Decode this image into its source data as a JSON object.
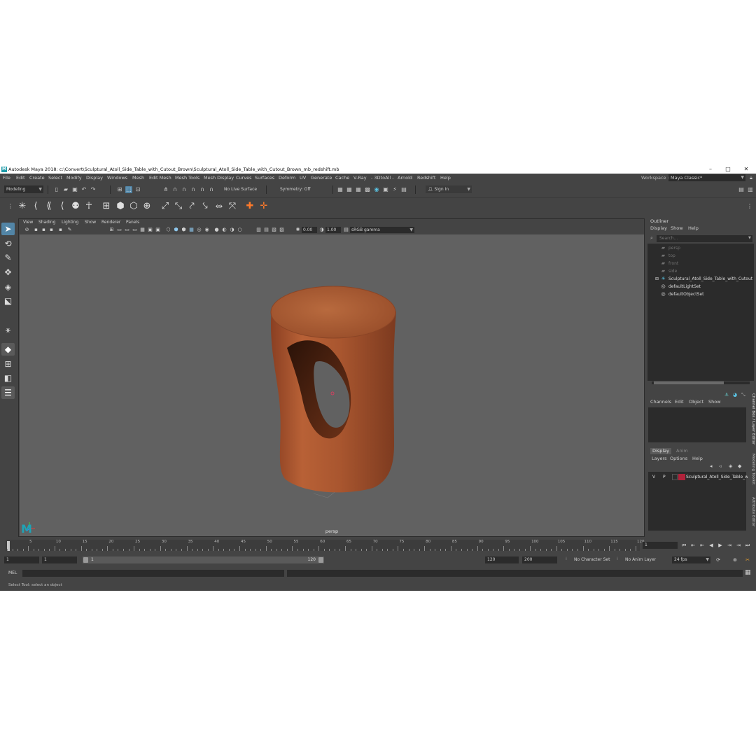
{
  "window": {
    "app_icon": "M",
    "title": "Autodesk Maya 2018: c:\\Convert\\Sculptural_Atoll_Side_Table_with_Cutout_Brown\\Sculptural_Atoll_Side_Table_with_Cutout_Brown_mb_redshift.mb",
    "minimize": "–",
    "maximize": "□",
    "close": "✕"
  },
  "menubar": {
    "items": [
      "File",
      "Edit",
      "Create",
      "Select",
      "Modify",
      "Display",
      "Windows",
      "Mesh",
      "Edit Mesh",
      "Mesh Tools",
      "Mesh Display",
      "Curves",
      "Surfaces",
      "Deform",
      "UV",
      "Generate",
      "Cache",
      "V-Ray",
      "- 3DtoAll -",
      "Arnold",
      "Redshift",
      "Help"
    ],
    "workspace_label": "Workspace :",
    "workspace_value": "Maya Classic*"
  },
  "statusline": {
    "mode": "Modeling",
    "live_surface": "No Live Surface",
    "symmetry": "Symmetry: Off",
    "sign_in": "Sign In"
  },
  "viewport": {
    "menu": [
      "View",
      "Shading",
      "Lighting",
      "Show",
      "Renderer",
      "Panels"
    ],
    "exposure": "0.00",
    "gamma": "1.00",
    "color_space": "sRGB gamma",
    "camera_label": "persp",
    "logo": "M"
  },
  "outliner": {
    "title": "Outliner",
    "menu": [
      "Display",
      "Show",
      "Help"
    ],
    "search_placeholder": "Search...",
    "items": [
      {
        "label": "persp",
        "icon": "camera-icon",
        "dim": true
      },
      {
        "label": "top",
        "icon": "camera-icon",
        "dim": true
      },
      {
        "label": "front",
        "icon": "camera-icon",
        "dim": true
      },
      {
        "label": "side",
        "icon": "camera-icon",
        "dim": true
      },
      {
        "label": "Sculptural_Atoll_Side_Table_with_Cutout",
        "icon": "group-icon",
        "dim": false
      },
      {
        "label": "defaultLightSet",
        "icon": "set-icon",
        "dim": false
      },
      {
        "label": "defaultObjectSet",
        "icon": "set-icon",
        "dim": false
      }
    ]
  },
  "channelbox": {
    "menu": [
      "Channels",
      "Edit",
      "Object",
      "Show"
    ]
  },
  "layer_editor": {
    "tabs": [
      "Display",
      "Anim"
    ],
    "menu": [
      "Layers",
      "Options",
      "Help"
    ],
    "layer": {
      "visible": "V",
      "playback": "P",
      "name": "Sculptural_Atoll_Side_Table_wi",
      "color": "#b0223a"
    }
  },
  "right_tabs": [
    "Channel Box / Layer Editor",
    "Modeling Toolkit",
    "Attribute Editor"
  ],
  "timeslider": {
    "ticks": [
      "5",
      "10",
      "15",
      "20",
      "25",
      "30",
      "35",
      "40",
      "45",
      "50",
      "55",
      "60",
      "65",
      "70",
      "75",
      "80",
      "85",
      "90",
      "95",
      "100",
      "105",
      "110",
      "115",
      "120"
    ],
    "current_frame": "1"
  },
  "range": {
    "start": "1",
    "playback_start": "1",
    "bar_start": "1",
    "bar_end": "120",
    "playback_end": "120",
    "end": "200",
    "character_set": "No Character Set",
    "anim_layer": "No Anim Layer",
    "fps": "24 fps"
  },
  "cmdline": {
    "label": "MEL"
  },
  "helpline": {
    "text": "Select Tool: select an object"
  },
  "colors": {
    "accent": "#5285a6",
    "object": "#a9562f",
    "viewport_bg": "#616161",
    "panel_bg": "#444444"
  }
}
